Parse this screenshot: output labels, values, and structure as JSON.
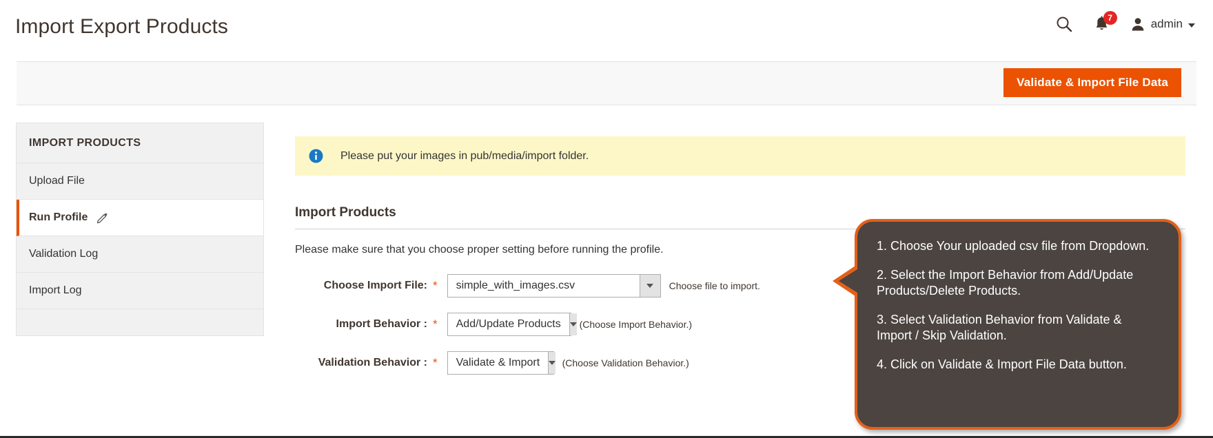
{
  "header": {
    "title": "Import Export Products",
    "search_icon": "search-icon",
    "notifications_icon": "bell-icon",
    "notifications_count": "7",
    "user_icon": "user-avatar-icon",
    "user_name": "admin",
    "caret_icon": "chevron-down-icon"
  },
  "toolbar": {
    "primary_button": "Validate & Import File Data"
  },
  "sidebar": {
    "title": "IMPORT PRODUCTS",
    "items": [
      {
        "label": "Upload File",
        "active": false
      },
      {
        "label": "Run Profile",
        "active": true,
        "icon": "pencil-icon"
      },
      {
        "label": "Validation Log",
        "active": false
      },
      {
        "label": "Import Log",
        "active": false
      }
    ]
  },
  "main": {
    "notice": {
      "icon": "info-circle-icon",
      "text": "Please put your images in pub/media/import folder."
    },
    "section_title": "Import Products",
    "helper_text": "Please make sure that you choose proper setting before running the profile.",
    "fields": [
      {
        "label": "Choose Import File:",
        "required": "*",
        "value": "simple_with_images.csv",
        "hint": "Choose file to import.",
        "arrow_icon": "chevron-down-icon"
      },
      {
        "label": "Import Behavior :",
        "required": "*",
        "value": "Add/Update Products",
        "hint": "(Choose Import Behavior.)",
        "arrow_icon": "chevron-down-icon"
      },
      {
        "label": "Validation Behavior :",
        "required": "*",
        "value": "Validate & Import",
        "hint": "(Choose Validation Behavior.)",
        "arrow_icon": "chevron-down-icon"
      }
    ]
  },
  "callout": {
    "lines": [
      "1. Choose Your uploaded csv file from Dropdown.",
      "2. Select the Import Behavior from Add/Update Products/Delete Products.",
      "3. Select Validation Behavior from Validate & Import / Skip Validation.",
      "4. Click on Validate & Import File Data button."
    ]
  },
  "colors": {
    "accent_orange": "#eb5202",
    "callout_border": "#e2601a",
    "callout_bg": "#4b4440",
    "notice_bg": "#fdf7c8",
    "badge_red": "#e22626",
    "info_blue": "#1979c3"
  }
}
